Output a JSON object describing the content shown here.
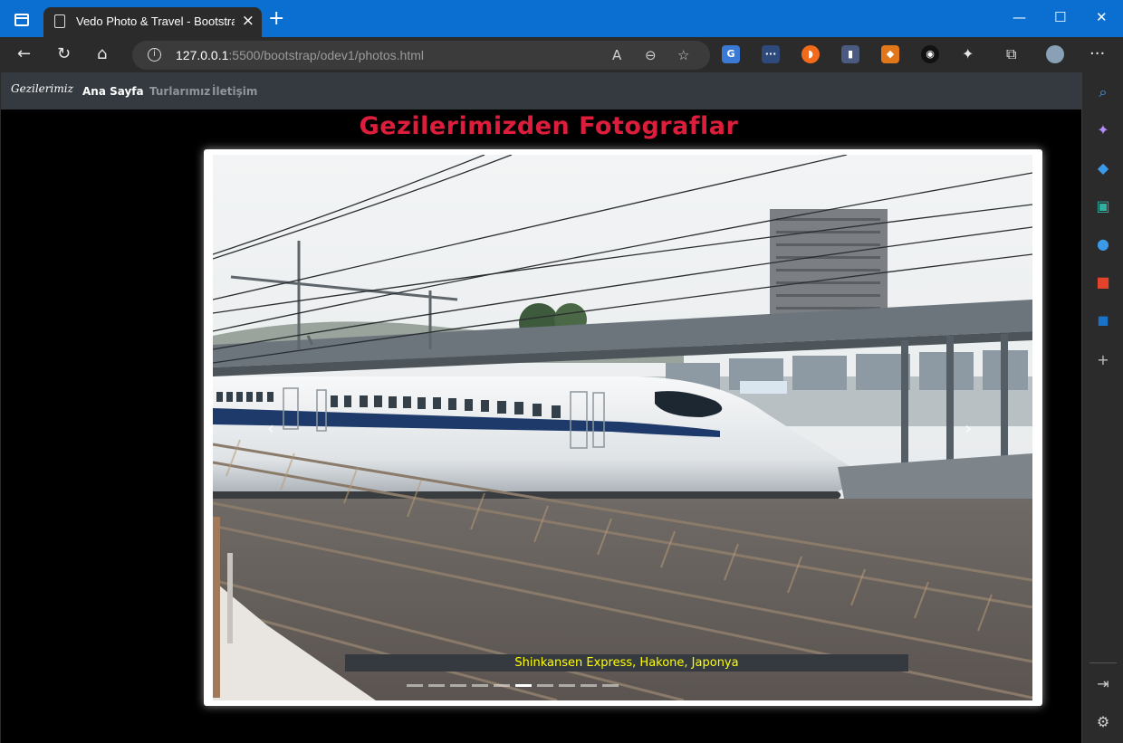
{
  "browser": {
    "tab_title": "Vedo Photo & Travel - Bootstrap",
    "url_host": "127.0.0.1",
    "url_rest": ":5500/bootstrap/odev1/photos.html",
    "new_tab": "+",
    "tab_close": "×",
    "window_controls": [
      "—",
      "☐",
      "✕"
    ]
  },
  "site": {
    "brand": "Gezilerimiz",
    "nav": [
      {
        "label": "Ana Sayfa",
        "active": true
      },
      {
        "label": "Turlarımız",
        "active": false
      },
      {
        "label": "İletişim",
        "active": false
      }
    ],
    "title": "Gezilerimizden Fotograflar",
    "title_color": "#dc1e3c"
  },
  "carousel": {
    "caption": "Shinkansen Express, Hakone, Japonya",
    "caption_color": "#ffff00",
    "prev_icon": "chevron-left-icon",
    "next_icon": "chevron-right-icon",
    "active_index": 5,
    "slide_count": 10
  }
}
